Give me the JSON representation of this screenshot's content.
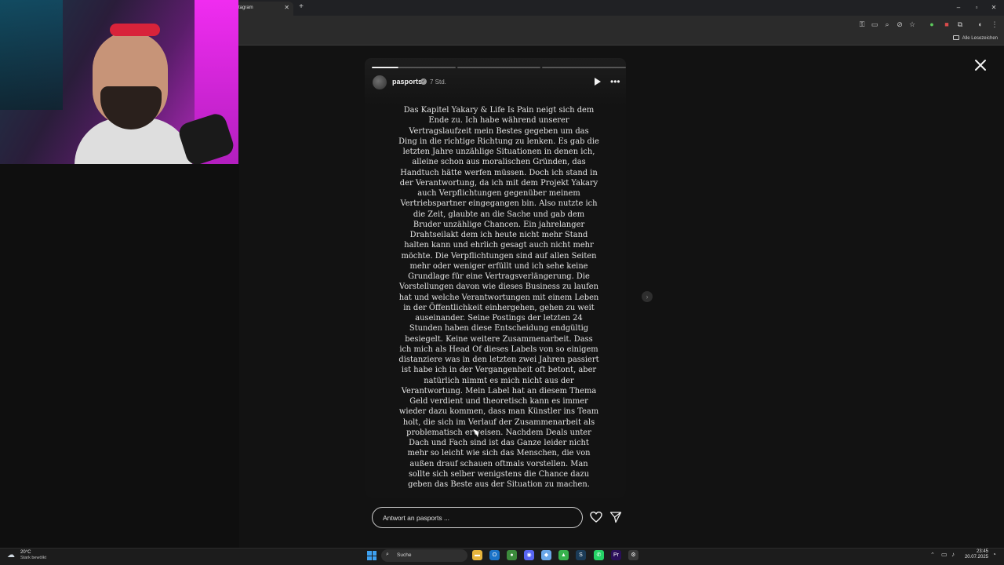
{
  "browser": {
    "tab_title": "tagram",
    "tab_close": "✕",
    "new_tab": "+",
    "bookmarks_all": "Alle Lesezeichen",
    "window_controls": [
      "–",
      "▫",
      "✕"
    ]
  },
  "story": {
    "username": "pasports",
    "verified_mark": "✓",
    "posted_ago": "7 Std.",
    "more_glyph": "•••",
    "progress": [
      1,
      0,
      0,
      0
    ],
    "text": "Das Kapitel Yakary & Life Is Pain neigt sich dem Ende zu. Ich habe während unserer Vertragslaufzeit mein Bestes gegeben um das Ding in die richtige Richtung zu lenken. Es gab die letzten Jahre unzählige Situationen in denen ich, alleine schon aus moralischen Gründen, das Handtuch hätte werfen müssen. Doch ich stand in der Verantwortung, da ich mit dem Projekt Yakary auch Verpflichtungen gegenüber meinem Vertriebspartner eingegangen bin. Also nutzte ich die Zeit, glaubte an die Sache und gab dem Bruder unzählige Chancen. Ein jahrelanger Drahtseilakt dem ich heute nicht mehr Stand halten kann und ehrlich gesagt auch nicht mehr möchte. Die Verpflichtungen sind auf allen Seiten mehr oder weniger erfüllt und ich sehe keine Grundlage für eine Vertragsverlängerung. Die Vorstellungen davon wie dieses Business zu laufen hat und welche Verantwortungen mit einem Leben in der Öffentlichkeit einhergehen, gehen zu weit auseinander. Seine Postings der letzten 24 Stunden haben diese Entscheidung endgültig besiegelt. Keine weitere Zusammenarbeit. Dass ich mich als Head Of dieses Labels von so einigem distanziere was in den letzten zwei Jahren passiert ist habe ich in der Vergangenheit oft betont, aber natürlich nimmt es mich nicht aus der Verantwortung. Mein Label hat an diesem Thema Geld verdient und theoretisch kann es immer wieder dazu kommen, dass man Künstler ins Team holt, die sich im Verlauf der Zusammenarbeit als problematisch erweisen. Nachdem Deals unter Dach und Fach sind ist das Ganze leider nicht mehr so leicht wie sich das Menschen, die von außen drauf schauen oftmals vorstellen. Man sollte sich selber wenigstens die Chance dazu geben das Beste aus der Situation zu machen.",
    "reply_placeholder": "Antwort an pasports ...",
    "next_glyph": "›"
  },
  "taskbar": {
    "weather_icon": "☁",
    "weather_temp": "20°C",
    "weather_desc": "Stark bewölkt",
    "search_icon": "⌕",
    "search_label": "Suche",
    "tray_up": "⌃",
    "time": "23:45",
    "date": "20.07.2025",
    "apps": [
      {
        "name": "file-explorer-icon",
        "color": "#e8b53c",
        "glyph": "▬"
      },
      {
        "name": "outlook-icon",
        "color": "#1a73c8",
        "glyph": "O"
      },
      {
        "name": "chrome-icon",
        "color": "#3c8b3c",
        "glyph": "●"
      },
      {
        "name": "discord-icon",
        "color": "#5865f2",
        "glyph": "◉"
      },
      {
        "name": "app-droplet-icon",
        "color": "#6aa8e8",
        "glyph": "◆"
      },
      {
        "name": "app-green-icon",
        "color": "#37b24d",
        "glyph": "▲"
      },
      {
        "name": "steam-icon",
        "color": "#1b3b57",
        "glyph": "S"
      },
      {
        "name": "whatsapp-icon",
        "color": "#25d366",
        "glyph": "✆"
      },
      {
        "name": "premiere-icon",
        "color": "#2a0f59",
        "glyph": "Pr"
      },
      {
        "name": "settings-icon",
        "color": "#3a3a3a",
        "glyph": "⚙"
      }
    ]
  }
}
